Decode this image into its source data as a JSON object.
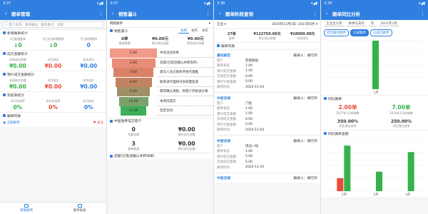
{
  "status": {
    "time1": "3:37",
    "time2": "3:37",
    "time3": "3:38",
    "time4": "3:39"
  },
  "s1": {
    "title": "跟单管理",
    "search_placeholder": "客户名称、跟单编号、跟单要点、详情",
    "sec_new": "新增跟单统计",
    "new_kpis": [
      {
        "label": "3日新增跟单",
        "value": "0"
      },
      {
        "label": "3日对比新增跟单",
        "value": "0"
      },
      {
        "label": "今日新增跟单",
        "value": "0"
      }
    ],
    "sec_deal": "成交金额统计",
    "deal_kpis": [
      {
        "label": "本周成交金额",
        "value": "¥0.00"
      },
      {
        "label": "本月成交",
        "value": "¥0.00"
      },
      {
        "label": "本年成交",
        "value": "¥0.00"
      }
    ],
    "sec_plan": "预计成交金额统计",
    "plan_kpis": [
      {
        "label": "本周成交金额",
        "value": "¥0.00"
      },
      {
        "label": "本月成交",
        "value": "¥0.00"
      },
      {
        "label": "本年成交",
        "value": "¥0.00"
      }
    ],
    "sec_done": "完成率统计",
    "done_kpis": [
      {
        "label": "本月完成率",
        "value": "0%"
      },
      {
        "label": "本年完成率",
        "value": "0%"
      },
      {
        "label": "本月成交",
        "value": "0%"
      }
    ],
    "sec_list": "跟单列表",
    "list_items": [
      {
        "label": "全部跟单"
      },
      {
        "label": "关注"
      }
    ],
    "tabs": [
      {
        "label": "新建跟单"
      },
      {
        "label": "跟单报表"
      }
    ]
  },
  "s2": {
    "title": "销售漏斗",
    "group": "网络跟单",
    "sec_funnel": "销售漏斗",
    "toggle": [
      "本周",
      "本月",
      "本年"
    ],
    "kpis": [
      {
        "label": "跟单数量",
        "value": "0单"
      },
      {
        "label": "预计成交金额",
        "value": "¥0.00元"
      },
      {
        "label": "提成成交金额",
        "value": "¥0.00元"
      }
    ],
    "funnel": [
      {
        "value": "1.00",
        "label": "中途洽谈有希",
        "color": "#f19a8a"
      },
      {
        "value": "2.00",
        "label": "您部(已电话确认并转询单)",
        "color": "#e98c77"
      },
      {
        "value": "3.00",
        "label": "意向人员已联系开始代理推",
        "color": "#d98268"
      },
      {
        "value": "4.00",
        "label": "联系进代理研讨会商量后成",
        "color": "#c18360"
      },
      {
        "value": "5.00",
        "label": "需求确认清楚，和客户开始谈价格",
        "color": "#a09068"
      },
      {
        "value": "10.00",
        "label": "本周内成交",
        "color": "#7aa26a"
      },
      {
        "value": "15.00",
        "label": "签定合同",
        "color": "#3daf59"
      }
    ],
    "sec_stats": "中途放弃成交客户",
    "stats": [
      {
        "label": "估算金额",
        "value": "0"
      },
      {
        "label": "预计成交金额",
        "value": "¥0.00"
      }
    ],
    "stats2": [
      {
        "label": "跟单数量",
        "value": "3"
      },
      {
        "label": "预计成交金额",
        "value": "¥0.00"
      }
    ],
    "sec_more": "您部(已电话确认并转询单)"
  },
  "s3": {
    "title": "跟单阶段查询",
    "filter_left": "王业",
    "date_range": "2020年11月3日--2021年6月",
    "summary": [
      {
        "label": "跟单",
        "value": "27单"
      },
      {
        "label": "预计成交金额",
        "value": "¥122750.00元"
      },
      {
        "label": "实际成交",
        "value": "¥18000.00元"
      }
    ],
    "sec_list": "跟单列表",
    "records": [
      {
        "type": "意向报告",
        "owner": "跟单人：胡巧玲",
        "fields": [
          {
            "k": "客户",
            "v": "凯佩旗居"
          },
          {
            "k": "跟单状态",
            "v": "1.00"
          },
          {
            "k": "预计成交金额",
            "v": "1.00"
          },
          {
            "k": "实际成交金额",
            "v": "0.00"
          },
          {
            "k": "预计计提金额",
            "v": "0.00"
          },
          {
            "k": "跟单时间",
            "v": "2020-11-04"
          }
        ]
      },
      {
        "type": "中途洽谈",
        "owner": "跟单人：胡巧玲",
        "fields": [
          {
            "k": "客户",
            "v": "门窗"
          },
          {
            "k": "跟单状态",
            "v": "1.00"
          },
          {
            "k": "预计成交金额",
            "v": "1.00"
          },
          {
            "k": "实际成交金额",
            "v": "0.00"
          },
          {
            "k": "预计计提金额",
            "v": "0.00"
          },
          {
            "k": "跟单时间",
            "v": "2020-11-04"
          }
        ]
      },
      {
        "type": "中途洽谈",
        "owner": "跟单人：胡巧玲",
        "fields": [
          {
            "k": "客户",
            "v": "周边一吨"
          },
          {
            "k": "跟单状态",
            "v": "1.00"
          },
          {
            "k": "预计成交金额",
            "v": "5.00"
          },
          {
            "k": "实际成交金额",
            "v": "5.00"
          },
          {
            "k": "跟单时间",
            "v": "2020-11-10"
          }
        ]
      },
      {
        "type": "中途洽谈",
        "owner": "跟单人：胡巧玲",
        "fields": []
      }
    ]
  },
  "s4": {
    "title": "跟单同比分析",
    "filters": [
      "王业主义务",
      "本季与去年",
      "年",
      "2021年1月"
    ],
    "pills": [
      {
        "label": "近年跟单趋势",
        "filled": false
      },
      {
        "label": "已成跟单",
        "filled": true
      },
      {
        "label": "已成交跟单",
        "filled": false
      }
    ],
    "sec_stats": "同比跟单",
    "compare": [
      {
        "value": "2.00单",
        "label": "2017年1月新增数",
        "cls": "red"
      },
      {
        "value": "7.00单",
        "label": "2018年1月新增数",
        "cls": "green"
      }
    ],
    "ratios": [
      {
        "value": "350.00%",
        "label": "同比增长效率"
      },
      {
        "value": "250.00%",
        "label": "同比增长效率"
      }
    ],
    "sec_amount": "同比跟单金额"
  },
  "chart_data": [
    {
      "type": "bar",
      "title": "",
      "categories": [
        "1月"
      ],
      "series": [
        {
          "name": "",
          "values": [
            1
          ]
        }
      ],
      "ylim": [
        0,
        1
      ],
      "grid": true
    },
    {
      "type": "bar",
      "title": "",
      "categories": [
        "1月",
        "2月",
        "3月"
      ],
      "series": [
        {
          "name": "",
          "values": [
            2,
            0,
            0
          ],
          "color": "#e94b3a"
        },
        {
          "name": "",
          "values": [
            7,
            3,
            6
          ],
          "color": "#36b24a"
        }
      ],
      "ylim": [
        0,
        8
      ],
      "grid": true
    }
  ],
  "colors": {
    "primary": "#2f7fe0",
    "green": "#36b24a",
    "red": "#e94b3a"
  }
}
